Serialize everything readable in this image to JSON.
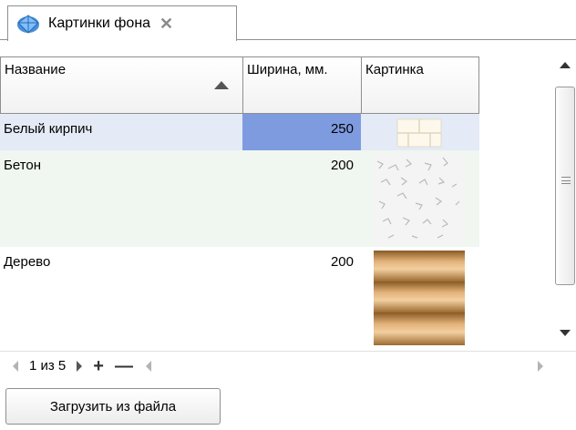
{
  "tab": {
    "title": "Картинки фона",
    "close_glyph": "✕"
  },
  "columns": [
    {
      "label": "Название"
    },
    {
      "label": "Ширина, мм."
    },
    {
      "label": "Картинка"
    }
  ],
  "rows": [
    {
      "name": "Белый кирпич",
      "width": "250",
      "picture": "brick-texture"
    },
    {
      "name": "Бетон",
      "width": "200",
      "picture": "concrete-texture"
    },
    {
      "name": "Дерево",
      "width": "200",
      "picture": "wood-texture"
    }
  ],
  "navigator": {
    "position": "1 из 5",
    "add": "+",
    "remove": "—"
  },
  "load_button": "Загрузить из файла",
  "colors": {
    "selected_cell": "#7f9be0",
    "selected_row": "#e4eaf6",
    "alt_row": "#f0f6f0",
    "border": "#8e8f8f"
  }
}
